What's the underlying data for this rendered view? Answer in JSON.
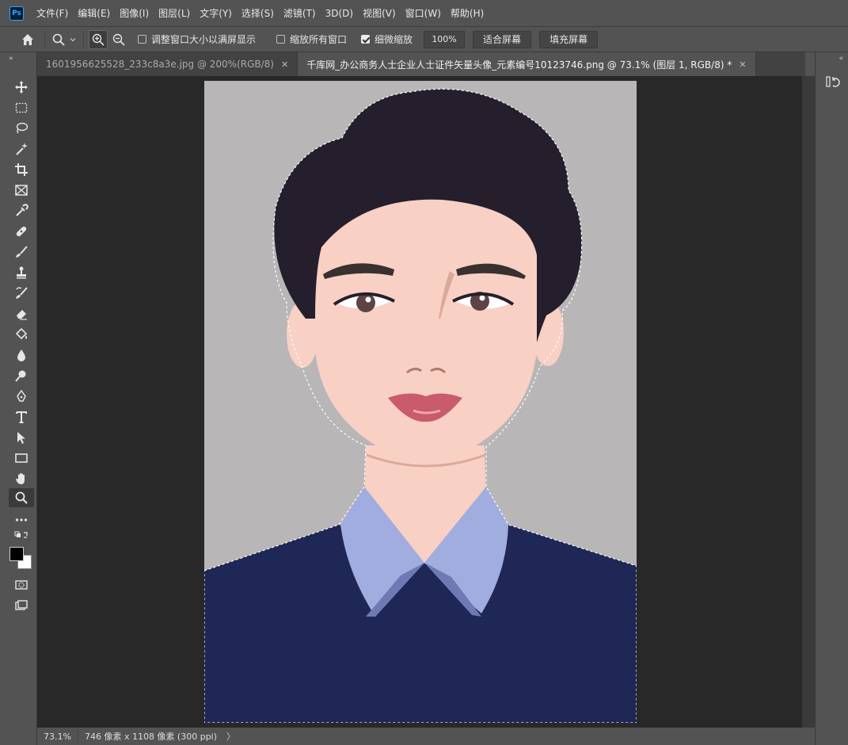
{
  "app": {
    "logo_text": "Ps"
  },
  "menu": [
    "文件(F)",
    "编辑(E)",
    "图像(I)",
    "图层(L)",
    "文字(Y)",
    "选择(S)",
    "滤镜(T)",
    "3D(D)",
    "视图(V)",
    "窗口(W)",
    "帮助(H)"
  ],
  "options": {
    "resize_windows_label": "调整窗口大小以满屏显示",
    "resize_windows_checked": false,
    "zoom_all_label": "缩放所有窗口",
    "zoom_all_checked": false,
    "scrubby_zoom_label": "细微缩放",
    "scrubby_zoom_checked": true,
    "zoom_value": "100%",
    "fit_screen_label": "适合屏幕",
    "fill_screen_label": "填充屏幕"
  },
  "tabs": [
    {
      "title": "1601956625528_233c8a3e.jpg @ 200%(RGB/8)",
      "active": false
    },
    {
      "title": "千库网_办公商务人士企业人士证件矢量头像_元素编号10123746.png @ 73.1% (图层 1, RGB/8) *",
      "active": true
    }
  ],
  "status": {
    "zoom": "73.1%",
    "doc_info": "746 像素 x 1108 像素 (300 ppi)",
    "arrow": "〉"
  },
  "colors": {
    "background_gray": "#b8b6b7",
    "hair": "#251e2c",
    "skin": "#f9d0c4",
    "shirt": "#1e2756",
    "collar": "#a2addf",
    "collar_shade": "#6f7ab4",
    "lips": "#c95b6c",
    "eyebrow": "#3a3030"
  },
  "tools": [
    "move-icon",
    "marquee-icon",
    "lasso-icon",
    "magic-wand-icon",
    "crop-icon",
    "frame-icon",
    "eyedropper-icon",
    "healing-icon",
    "brush-icon",
    "stamp-icon",
    "history-brush-icon",
    "eraser-icon",
    "paint-bucket-icon",
    "blur-icon",
    "dodge-icon",
    "pen-icon",
    "type-icon",
    "path-select-icon",
    "rectangle-icon",
    "hand-icon",
    "zoom-icon",
    "more-tools-icon",
    "color-swatches",
    "quick-mask-icon",
    "screen-mode-icon"
  ]
}
